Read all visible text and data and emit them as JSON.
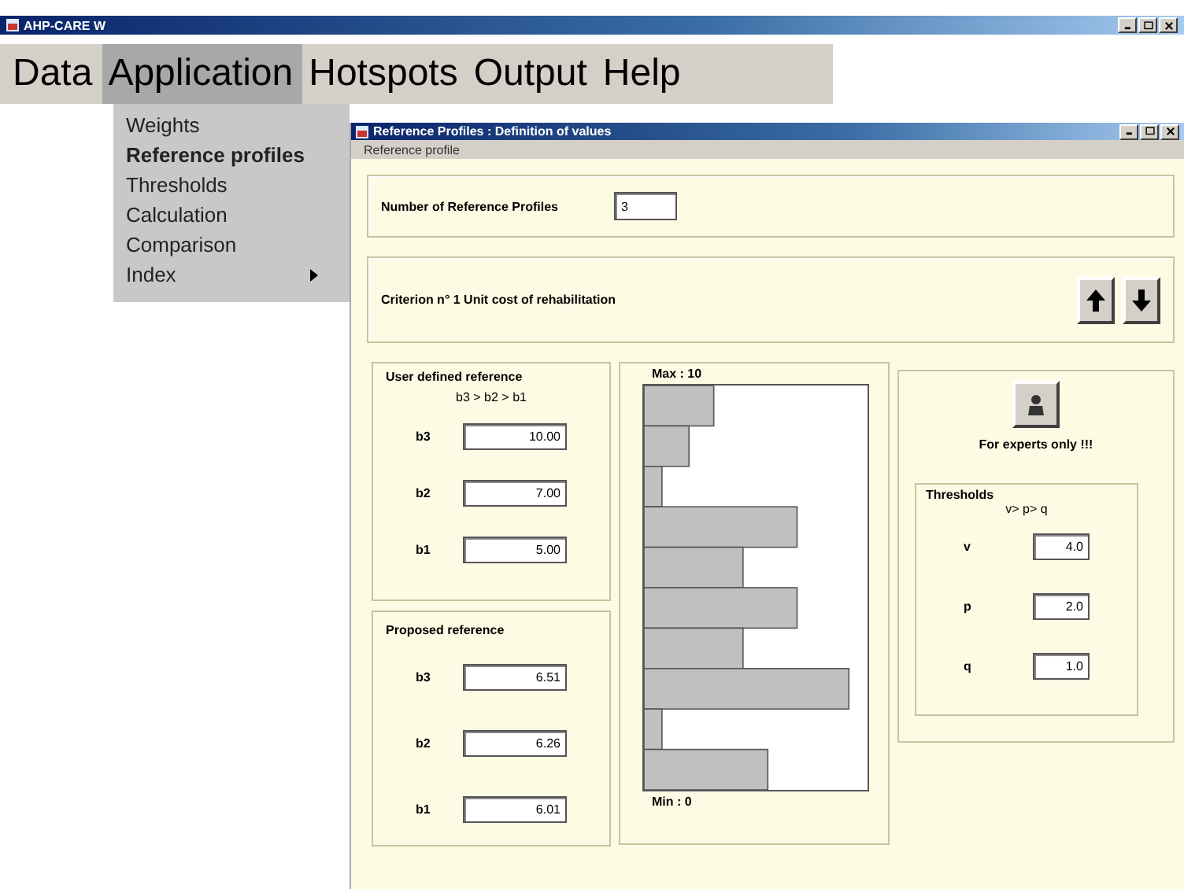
{
  "window": {
    "title": "AHP-CARE W"
  },
  "menu": [
    {
      "label": "Data",
      "selected": false
    },
    {
      "label": "Application",
      "selected": true
    },
    {
      "label": "Hotspots",
      "selected": false
    },
    {
      "label": "Output",
      "selected": false
    },
    {
      "label": "Help",
      "selected": false
    }
  ],
  "dropdown": [
    {
      "label": "Weights",
      "bold": false,
      "submenu": false
    },
    {
      "label": "Reference profiles",
      "bold": true,
      "submenu": false
    },
    {
      "label": "Thresholds",
      "bold": false,
      "submenu": false
    },
    {
      "label": "Calculation",
      "bold": false,
      "submenu": false
    },
    {
      "label": "Comparison",
      "bold": false,
      "submenu": false
    },
    {
      "label": "Index",
      "bold": false,
      "submenu": true
    }
  ],
  "child": {
    "title": "Reference Profiles : Definition of values",
    "menu": "Reference profile",
    "profiles_label": "Number of Reference Profiles",
    "profiles_value": "3",
    "criterion": "Criterion n° 1 Unit cost of rehabilitation",
    "user_defined": {
      "title": "User defined reference",
      "order": "b3 > b2 > b1",
      "fields": [
        {
          "label": "b3",
          "value": "10.00"
        },
        {
          "label": "b2",
          "value": "7.00"
        },
        {
          "label": "b1",
          "value": "5.00"
        }
      ]
    },
    "proposed": {
      "title": "Proposed reference",
      "fields": [
        {
          "label": "b3",
          "value": "6.51"
        },
        {
          "label": "b2",
          "value": "6.26"
        },
        {
          "label": "b1",
          "value": "6.01"
        }
      ]
    },
    "histogram": {
      "max_label": "Max : 10",
      "min_label": "Min : 0"
    },
    "experts": "For experts only !!!",
    "thresholds": {
      "title": "Thresholds",
      "order": "v> p> q",
      "fields": [
        {
          "label": "v",
          "value": "4.0"
        },
        {
          "label": "p",
          "value": "2.0"
        },
        {
          "label": "q",
          "value": "1.0"
        }
      ]
    }
  }
}
